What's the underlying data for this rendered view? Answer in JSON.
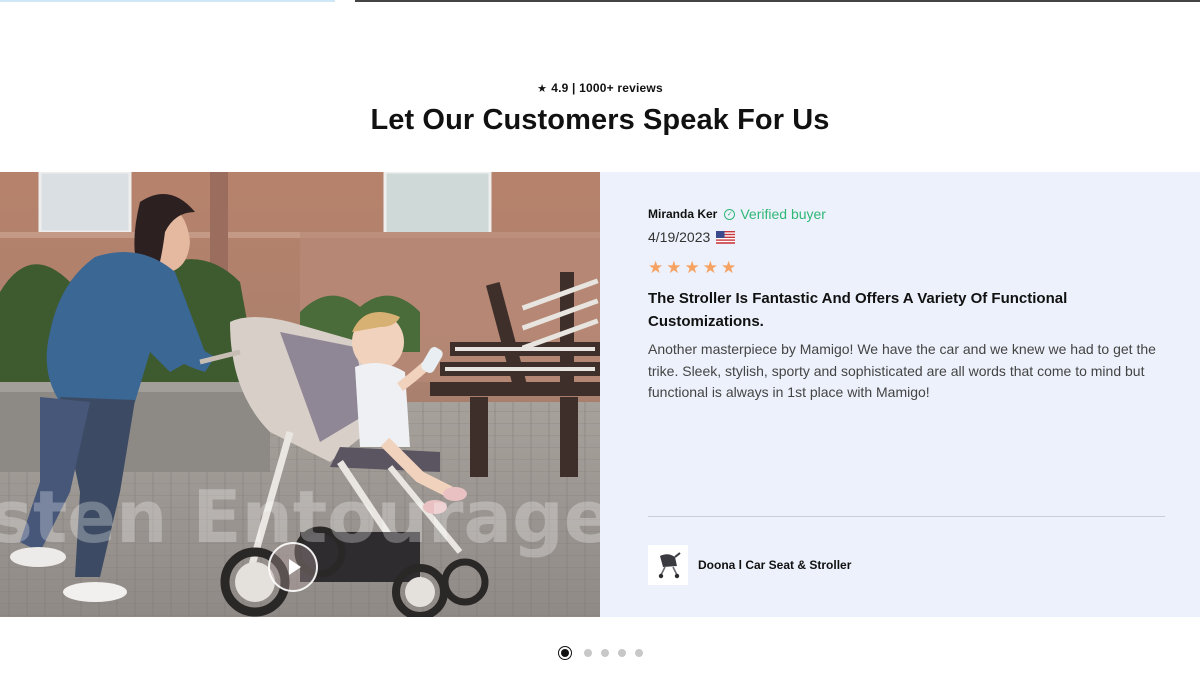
{
  "header": {
    "rating_star": "★",
    "rating_text": "4.9 | 1000+ reviews",
    "title": "Let Our Customers Speak For Us"
  },
  "review": {
    "reviewer_name": "Miranda Ker",
    "verified_label": "Verified buyer",
    "date": "4/19/2023",
    "country_flag": "us-flag-icon",
    "star_rating": 5,
    "star_glyph": "★",
    "heading": "The Stroller Is Fantastic And Offers A Variety Of Functional Customizations.",
    "body": "Another masterpiece by Mamigo! We have the car and we knew we had to get the trike. Sleek, stylish, sporty and sophisticated are all words that come to mind but functional is always in 1st place with Mamigo!",
    "product_name": "Doona l Car Seat & Stroller"
  },
  "media": {
    "play_icon": "play-icon",
    "watermark_text": "sten Entourage"
  },
  "carousel": {
    "total_slides": 5,
    "active_index": 0
  },
  "colors": {
    "review_panel_bg": "#edf1fb",
    "verified_green": "#2fb876",
    "star_orange": "#f5a262",
    "title_text": "#111111"
  }
}
